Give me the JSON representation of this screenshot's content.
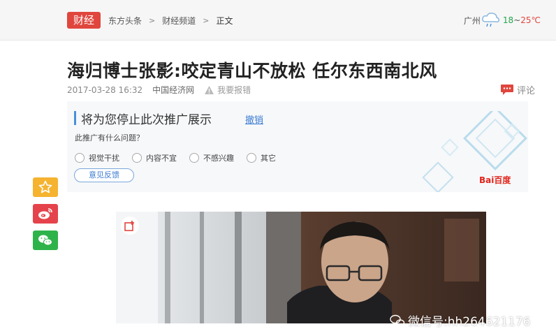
{
  "header": {
    "channel_badge": "财经",
    "breadcrumb": [
      "东方头条",
      "财经频道",
      "正文"
    ],
    "breadcrumb_separator": ">",
    "weather": {
      "city": "广州",
      "temp_low": "18",
      "tilde": "~",
      "temp_high": "25℃",
      "icon": "cloud-rain-icon"
    }
  },
  "article": {
    "title": "海归博士张影:咬定青山不放松 任尔东西南北风",
    "date": "2017-03-28 16:32",
    "source": "中国经济网",
    "report_label": "我要报错",
    "comment_label": "评论"
  },
  "ad_feedback": {
    "heading": "将为您停止此次推广展示",
    "undo_label": "撤销",
    "question": "此推广有什么问题？",
    "options": [
      "视觉干扰",
      "内容不宜",
      "不感兴趣",
      "其它"
    ],
    "feedback_button": "意见反馈",
    "brand": "Bai百度"
  },
  "share": {
    "favorite_icon": "star-icon",
    "weibo_icon": "weibo-icon",
    "wechat_icon": "wechat-icon"
  },
  "photo": {
    "watermark": "微信号:hh264621176"
  },
  "colors": {
    "accent_red": "#e0463d",
    "link_blue": "#3b7bd2",
    "share_yellow": "#f5b330",
    "share_red": "#e5434b",
    "share_green": "#2eb34a"
  }
}
